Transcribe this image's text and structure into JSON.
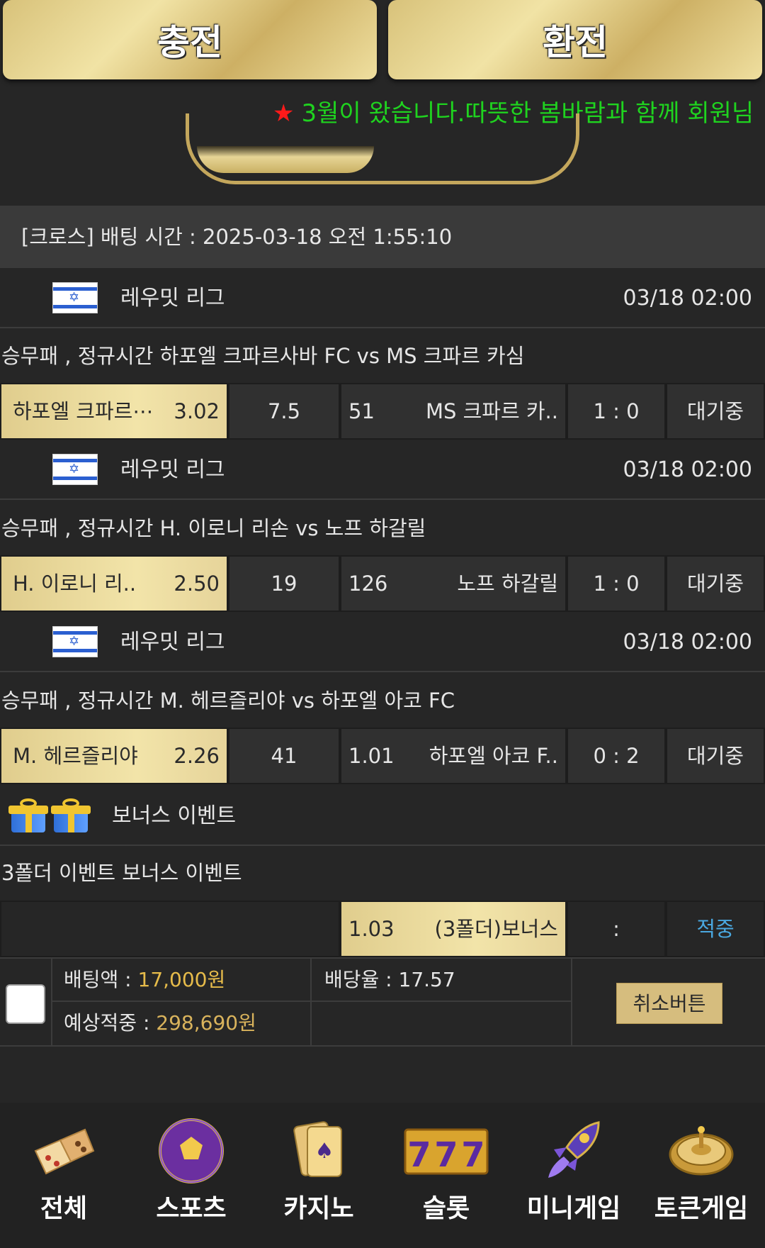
{
  "top_buttons": {
    "charge": "충전",
    "exchange": "환전"
  },
  "notice": {
    "star": "★",
    "text": "3월이 왔습니다.따뜻한 봄바람과 함께 회원님"
  },
  "bet_header": "[크로스] 배팅 시간 : 2025-03-18 오전 1:55:10",
  "matches": [
    {
      "league": "레우밋 리그",
      "time": "03/18 02:00",
      "title": "승무패 , 정규시간 하포엘 크파르사바 FC  vs  MS 크파르 카심",
      "home": "하포엘 크파르⋯",
      "home_odds": "3.02",
      "draw": "7.5",
      "away_odds": "51",
      "away": "MS 크파르 카..",
      "score": "1 : 0",
      "status": "대기중"
    },
    {
      "league": "레우밋 리그",
      "time": "03/18 02:00",
      "title": "승무패 , 정규시간 H. 이로니 리손  vs  노프 하갈릴",
      "home": "H. 이로니 리..",
      "home_odds": "2.50",
      "draw": "19",
      "away_odds": "126",
      "away": "노프 하갈릴",
      "score": "1 : 0",
      "status": "대기중"
    },
    {
      "league": "레우밋 리그",
      "time": "03/18 02:00",
      "title": "승무패 , 정규시간 M. 헤르즐리야  vs  하포엘 아코 FC",
      "home": "M. 헤르즐리야",
      "home_odds": "2.26",
      "draw": "41",
      "away_odds": "1.01",
      "away": "하포엘 아코 F..",
      "score": "0 : 2",
      "status": "대기중"
    }
  ],
  "bonus": {
    "league": "보너스 이벤트",
    "title": "3폴더 이벤트 보너스 이벤트",
    "odds": "1.03",
    "name": "(3폴더)보너스",
    "score": ":",
    "status": "적중"
  },
  "bet_summary": {
    "amount_label": "배팅액 : ",
    "amount": "17,000원",
    "expected_label": "예상적중 : ",
    "expected": "298,690원",
    "rate_label": "배당율 : 17.57",
    "cancel": "취소버튼"
  },
  "nav": [
    {
      "label": "전체",
      "icon": "dice-icon"
    },
    {
      "label": "스포츠",
      "icon": "soccer-ball-icon"
    },
    {
      "label": "카지노",
      "icon": "cards-icon"
    },
    {
      "label": "슬롯",
      "icon": "slot-777-icon"
    },
    {
      "label": "미니게임",
      "icon": "rocket-icon"
    },
    {
      "label": "토큰게임",
      "icon": "roulette-icon"
    }
  ],
  "colors": {
    "gold": "#e6bb4a",
    "notice_green": "#1fd31f",
    "status_win": "#4aa8e0"
  }
}
